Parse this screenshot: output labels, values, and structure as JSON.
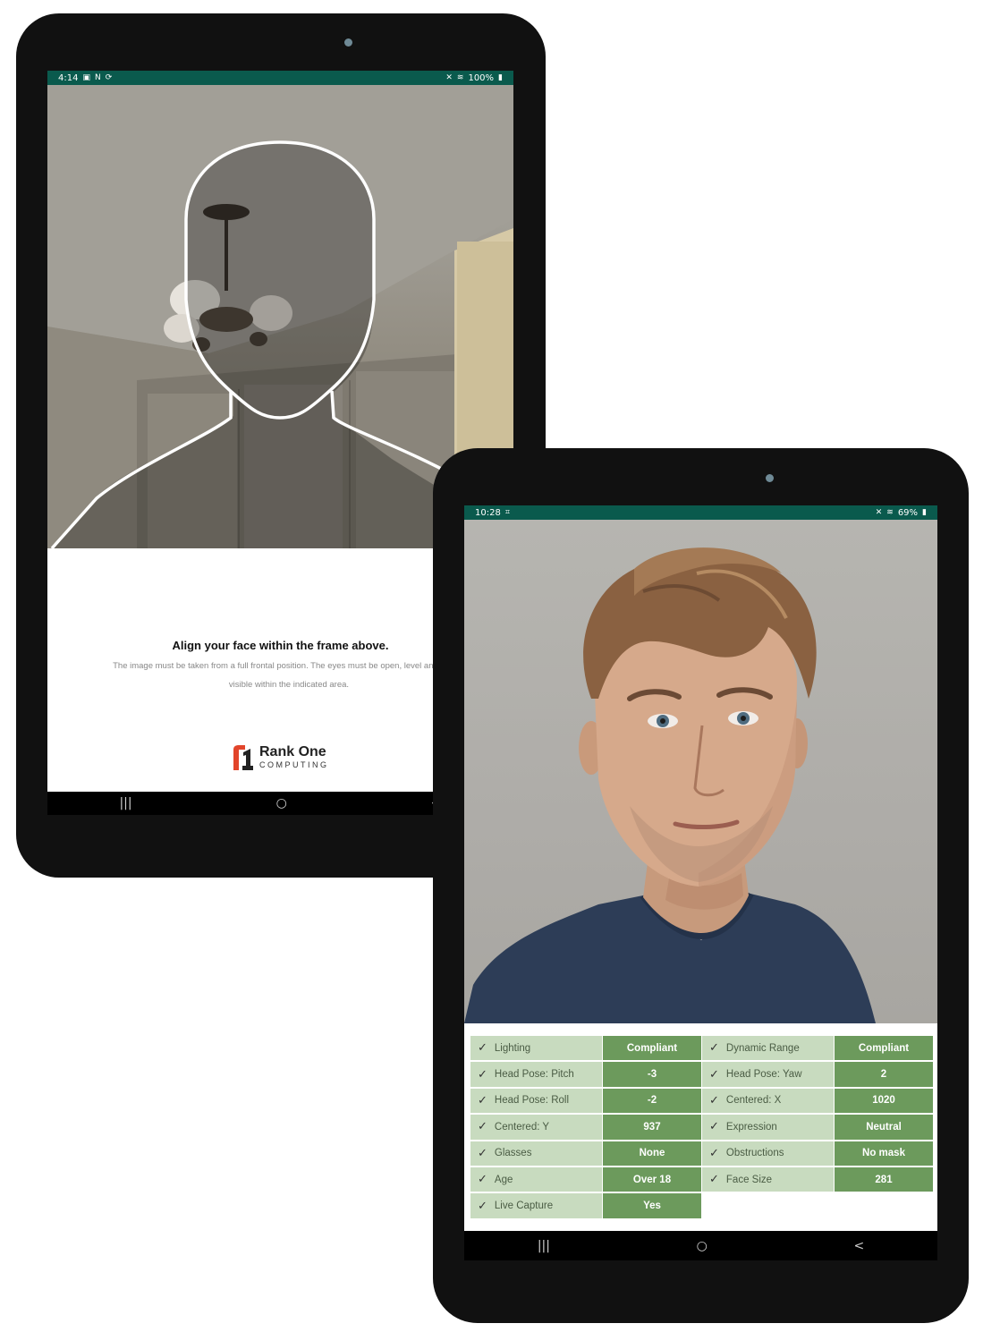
{
  "tablet1": {
    "statusbar": {
      "time": "4:14",
      "left_icons": [
        "gallery-icon",
        "nfc-icon",
        "sync-icon"
      ],
      "battery": "100%"
    },
    "instructions": {
      "title": "Align your face within the frame above.",
      "body": "The image must be taken from a full frontal position. The eyes must be open, level and clearly visible within the indicated area."
    },
    "logo": {
      "name": "Rank One",
      "sub": "COMPUTING"
    },
    "nav": {
      "recents": "|||",
      "home": "○",
      "back": "<"
    }
  },
  "tablet2": {
    "statusbar": {
      "time": "10:28",
      "battery": "69%"
    },
    "results": [
      {
        "label": "Lighting",
        "value": "Compliant"
      },
      {
        "label": "Dynamic Range",
        "value": "Compliant"
      },
      {
        "label": "Head Pose: Pitch",
        "value": "-3"
      },
      {
        "label": "Head Pose: Yaw",
        "value": "2"
      },
      {
        "label": "Head Pose: Roll",
        "value": "-2"
      },
      {
        "label": "Centered: X",
        "value": "1020"
      },
      {
        "label": "Centered: Y",
        "value": "937"
      },
      {
        "label": "Expression",
        "value": "Neutral"
      },
      {
        "label": "Glasses",
        "value": "None"
      },
      {
        "label": "Obstructions",
        "value": "No mask"
      },
      {
        "label": "Age",
        "value": "Over 18"
      },
      {
        "label": "Face Size",
        "value": "281"
      },
      {
        "label": "Live Capture",
        "value": "Yes"
      }
    ],
    "nav": {
      "recents": "|||",
      "home": "○",
      "back": "<"
    }
  },
  "colors": {
    "status_bar": "#0a5a4d",
    "label_cell": "#c8dbbf",
    "value_cell": "#6c9a5c",
    "logo_accent": "#e2452b"
  }
}
